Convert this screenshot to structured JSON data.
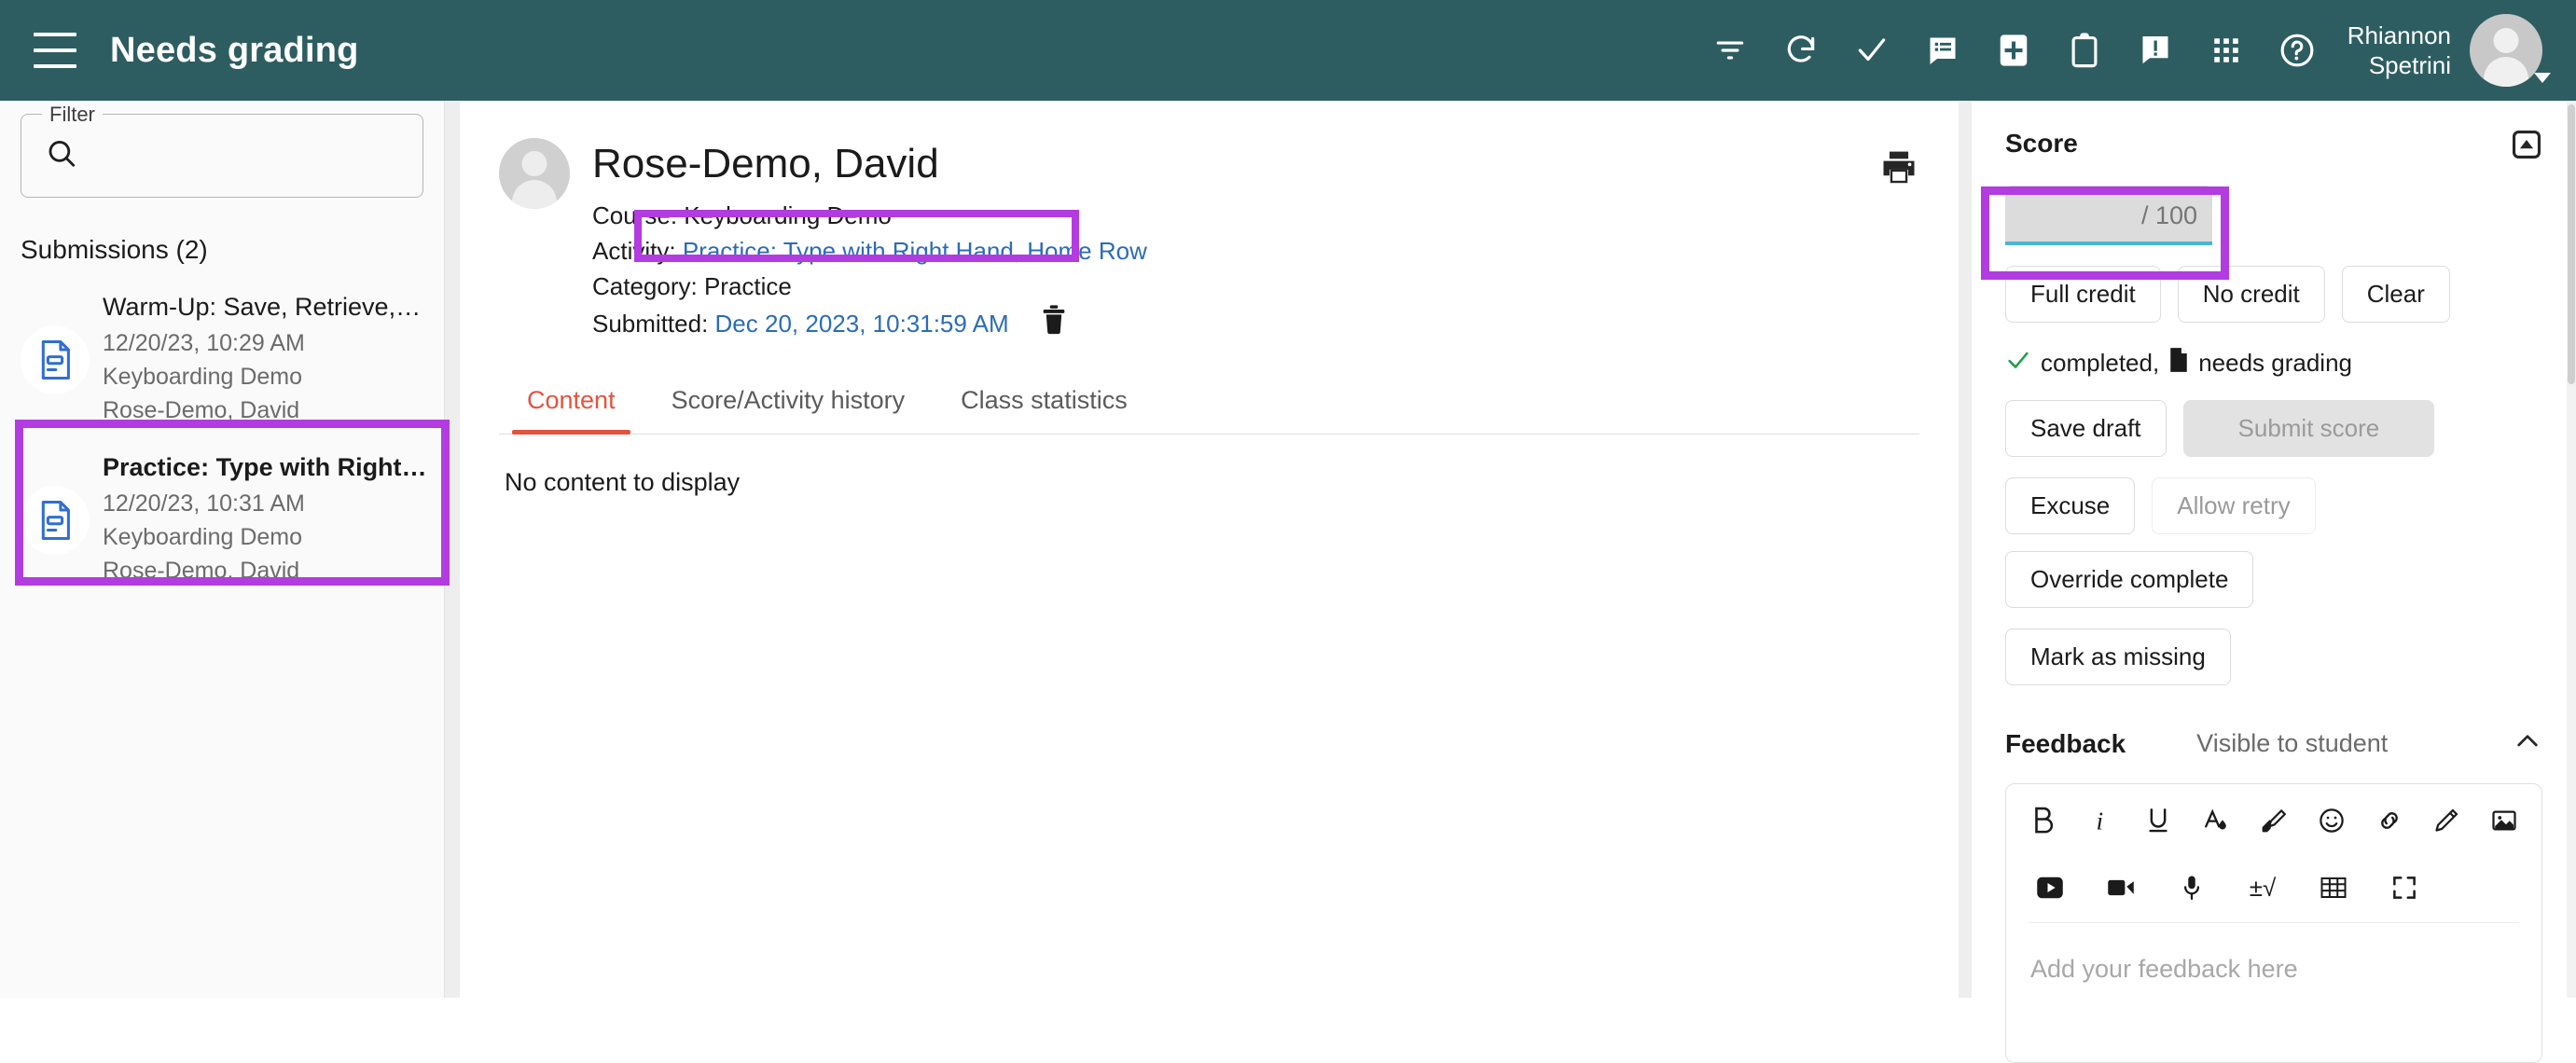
{
  "appbar": {
    "title": "Needs grading",
    "menu_icon": "hamburger-menu-icon",
    "icons": [
      {
        "name": "filter-icon",
        "label": "Filter"
      },
      {
        "name": "refresh-icon",
        "label": "Refresh"
      },
      {
        "name": "check-icon",
        "label": "Mark complete"
      },
      {
        "name": "message-list-icon",
        "label": "Messages"
      },
      {
        "name": "add-square-icon",
        "label": "Add"
      },
      {
        "name": "clipboard-icon",
        "label": "Clipboard"
      },
      {
        "name": "alert-message-icon",
        "label": "Alerts"
      },
      {
        "name": "apps-grid-icon",
        "label": "Apps"
      },
      {
        "name": "help-icon",
        "label": "Help"
      }
    ],
    "user_name_line1": "Rhiannon",
    "user_name_line2": "Spetrini",
    "brand_color": "#2d5d61"
  },
  "sidebar": {
    "filter_legend": "Filter",
    "filter_placeholder": "",
    "filter_value": "",
    "search_icon": "search-icon",
    "submissions_heading": "Submissions (2)",
    "items": [
      {
        "title": "Warm-Up: Save, Retrieve, and Dele…",
        "timestamp": "12/20/23, 10:29 AM",
        "course": "Keyboarding Demo",
        "student": "Rose-Demo, David",
        "icon": "document-icon",
        "active": false
      },
      {
        "title": "Practice: Type with Right Hand, H…",
        "timestamp": "12/20/23, 10:31 AM",
        "course": "Keyboarding Demo",
        "student": "Rose-Demo, David",
        "icon": "document-icon",
        "active": true
      }
    ]
  },
  "content": {
    "student_name": "Rose-Demo, David",
    "course_label": "Course:",
    "course_value": "Keyboarding Demo",
    "activity_label": "Activity:",
    "activity_value": "Practice: Type with Right Hand, Home Row",
    "category_label": "Category:",
    "category_value": "Practice",
    "submitted_label": "Submitted:",
    "submitted_value": "Dec 20, 2023, 10:31:59 AM",
    "delete_icon": "trash-icon",
    "print_icon": "print-icon",
    "tabs": [
      {
        "label": "Content",
        "active": true
      },
      {
        "label": "Score/Activity history",
        "active": false
      },
      {
        "label": "Class statistics",
        "active": false
      }
    ],
    "empty_text": "No content to display",
    "link_color": "#2b6cb8",
    "active_tab_color": "#e2543f"
  },
  "score_panel": {
    "heading": "Score",
    "collapse_icon": "collapse-panel-icon",
    "score_value": "",
    "score_suffix": "/ 100",
    "score_placeholder": "/ 100",
    "quick_buttons": [
      {
        "label": "Full credit",
        "disabled": false
      },
      {
        "label": "No credit",
        "disabled": false
      },
      {
        "label": "Clear",
        "disabled": false
      }
    ],
    "status_completed": "completed,",
    "status_needs_grading": "needs grading",
    "status_check_icon": "check-icon",
    "status_doc_icon": "document-filled-icon",
    "action_buttons_row1": [
      {
        "label": "Save draft",
        "disabled": false
      },
      {
        "label": "Submit score",
        "disabled": true
      }
    ],
    "action_buttons_row2": [
      {
        "label": "Excuse",
        "disabled": false
      },
      {
        "label": "Allow retry",
        "disabled": true
      },
      {
        "label": "Override complete",
        "disabled": false
      }
    ],
    "action_buttons_row3": [
      {
        "label": "Mark as missing",
        "disabled": false
      }
    ]
  },
  "feedback": {
    "title": "Feedback",
    "visibility": "Visible to student",
    "chevron_icon": "chevron-up-icon",
    "placeholder": "Add your feedback here",
    "toolbar_row1": [
      {
        "name": "bold-icon",
        "glyph": "B"
      },
      {
        "name": "italic-icon",
        "glyph": "i"
      },
      {
        "name": "underline-icon",
        "glyph": "U"
      },
      {
        "name": "text-color-icon",
        "glyph": "A"
      },
      {
        "name": "highlighter-icon",
        "glyph": ""
      },
      {
        "name": "emoji-icon",
        "glyph": ""
      },
      {
        "name": "link-icon",
        "glyph": ""
      },
      {
        "name": "pen-draw-icon",
        "glyph": ""
      },
      {
        "name": "insert-image-icon",
        "glyph": ""
      }
    ],
    "toolbar_row2": [
      {
        "name": "video-play-icon",
        "glyph": ""
      },
      {
        "name": "record-video-icon",
        "glyph": ""
      },
      {
        "name": "microphone-icon",
        "glyph": ""
      },
      {
        "name": "math-equation-icon",
        "glyph": "±√"
      },
      {
        "name": "insert-table-icon",
        "glyph": ""
      },
      {
        "name": "fullscreen-icon",
        "glyph": ""
      }
    ]
  },
  "annotations": {
    "color": "#b23ce0",
    "boxes": [
      "sidebar-selected-submission",
      "activity-link",
      "score-input"
    ]
  }
}
